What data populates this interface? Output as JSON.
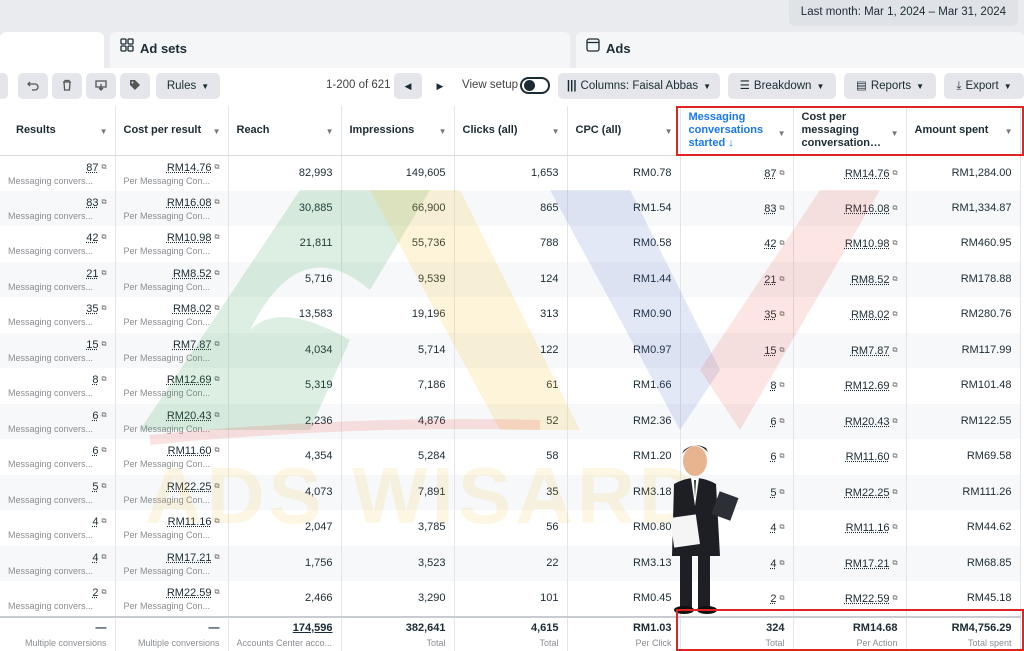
{
  "date_range": "Last month: Mar 1, 2024 – Mar 31, 2024",
  "tabs": [
    {
      "label": ""
    },
    {
      "label": "Ad sets"
    },
    {
      "label": "Ads"
    }
  ],
  "toolbar": {
    "rules": "Rules",
    "pager": "1-200 of 621",
    "view_setup": "View setup",
    "columns": "Columns: Faisal Abbas",
    "breakdown": "Breakdown",
    "reports": "Reports",
    "export": "Export"
  },
  "columns": {
    "results": "Results",
    "cost_per_result": "Cost per result",
    "reach": "Reach",
    "impressions": "Impressions",
    "clicks": "Clicks (all)",
    "cpc": "CPC (all)",
    "messaging_line1": "Messaging",
    "messaging_line2": "conversations",
    "messaging_line3": "started ↓",
    "cost_msg_line1": "Cost per",
    "cost_msg_line2": "messaging",
    "cost_msg_line3": "conversation…",
    "amount": "Amount spent"
  },
  "rows": [
    {
      "results": "87",
      "cpr": "RM14.76",
      "reach": "82,993",
      "impr": "149,605",
      "clicks": "1,653",
      "cpc": "RM0.78",
      "msg": "87",
      "cpm": "RM14.76",
      "amount": "RM1,284.00"
    },
    {
      "results": "83",
      "cpr": "RM16.08",
      "reach": "30,885",
      "impr": "66,900",
      "clicks": "865",
      "cpc": "RM1.54",
      "msg": "83",
      "cpm": "RM16.08",
      "amount": "RM1,334.87"
    },
    {
      "results": "42",
      "cpr": "RM10.98",
      "reach": "21,811",
      "impr": "55,736",
      "clicks": "788",
      "cpc": "RM0.58",
      "msg": "42",
      "cpm": "RM10.98",
      "amount": "RM460.95"
    },
    {
      "results": "21",
      "cpr": "RM8.52",
      "reach": "5,716",
      "impr": "9,539",
      "clicks": "124",
      "cpc": "RM1.44",
      "msg": "21",
      "cpm": "RM8.52",
      "amount": "RM178.88"
    },
    {
      "results": "35",
      "cpr": "RM8.02",
      "reach": "13,583",
      "impr": "19,196",
      "clicks": "313",
      "cpc": "RM0.90",
      "msg": "35",
      "cpm": "RM8.02",
      "amount": "RM280.76"
    },
    {
      "results": "15",
      "cpr": "RM7.87",
      "reach": "4,034",
      "impr": "5,714",
      "clicks": "122",
      "cpc": "RM0.97",
      "msg": "15",
      "cpm": "RM7.87",
      "amount": "RM117.99"
    },
    {
      "results": "8",
      "cpr": "RM12.69",
      "reach": "5,319",
      "impr": "7,186",
      "clicks": "61",
      "cpc": "RM1.66",
      "msg": "8",
      "cpm": "RM12.69",
      "amount": "RM101.48"
    },
    {
      "results": "6",
      "cpr": "RM20.43",
      "reach": "2,236",
      "impr": "4,876",
      "clicks": "52",
      "cpc": "RM2.36",
      "msg": "6",
      "cpm": "RM20.43",
      "amount": "RM122.55"
    },
    {
      "results": "6",
      "cpr": "RM11.60",
      "reach": "4,354",
      "impr": "5,284",
      "clicks": "58",
      "cpc": "RM1.20",
      "msg": "6",
      "cpm": "RM11.60",
      "amount": "RM69.58"
    },
    {
      "results": "5",
      "cpr": "RM22.25",
      "reach": "4,073",
      "impr": "7,891",
      "clicks": "35",
      "cpc": "RM3.18",
      "msg": "5",
      "cpm": "RM22.25",
      "amount": "RM111.26"
    },
    {
      "results": "4",
      "cpr": "RM11.16",
      "reach": "2,047",
      "impr": "3,785",
      "clicks": "56",
      "cpc": "RM0.80",
      "msg": "4",
      "cpm": "RM11.16",
      "amount": "RM44.62"
    },
    {
      "results": "4",
      "cpr": "RM17.21",
      "reach": "1,756",
      "impr": "3,523",
      "clicks": "22",
      "cpc": "RM3.13",
      "msg": "4",
      "cpm": "RM17.21",
      "amount": "RM68.85"
    },
    {
      "results": "2",
      "cpr": "RM22.59",
      "reach": "2,466",
      "impr": "3,290",
      "clicks": "101",
      "cpc": "RM0.45",
      "msg": "2",
      "cpm": "RM22.59",
      "amount": "RM45.18"
    }
  ],
  "row_sub": {
    "results": "Messaging convers...",
    "cpr": "Per Messaging Con..."
  },
  "totals": {
    "results": "—",
    "results_sub": "Multiple conversions",
    "cpr": "—",
    "cpr_sub": "Multiple conversions",
    "reach": "174,596",
    "reach_sub": "Accounts Center acco...",
    "impr": "382,641",
    "impr_sub": "Total",
    "clicks": "4,615",
    "clicks_sub": "Total",
    "cpc": "RM1.03",
    "cpc_sub": "Per Click",
    "msg": "324",
    "msg_sub": "Total",
    "cpm": "RM14.68",
    "cpm_sub": "Per Action",
    "amount": "RM4,756.29",
    "amount_sub": "Total spent"
  },
  "watermark": {
    "text": "ADS WISARD"
  },
  "colors": {
    "accent": "#1877f2",
    "highlight_box": "#e02424"
  }
}
